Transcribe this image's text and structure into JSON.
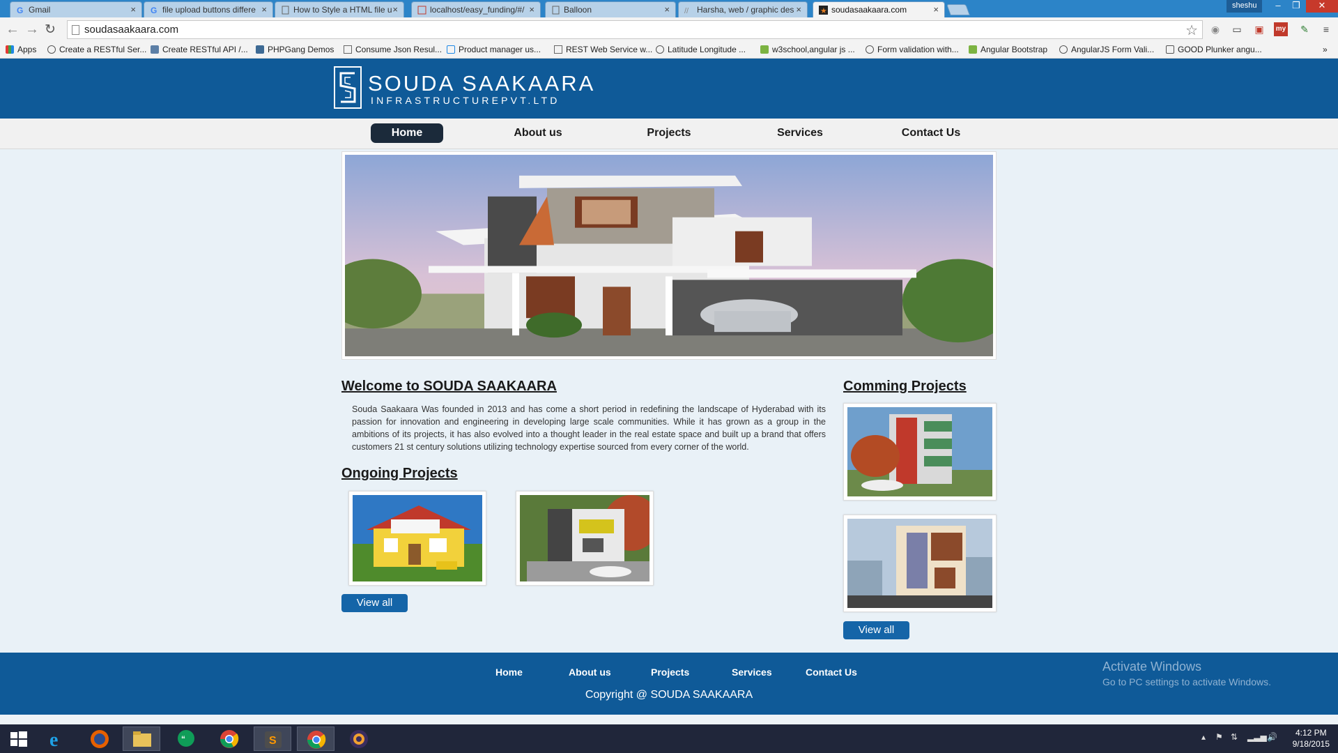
{
  "browser": {
    "tabs": [
      {
        "label": "Gmail",
        "icon": "google-icon"
      },
      {
        "label": "file upload buttons differe",
        "icon": "google-icon"
      },
      {
        "label": "How to Style a HTML file u",
        "icon": "page-icon"
      },
      {
        "label": "localhost/easy_funding/#/",
        "icon": "page-icon"
      },
      {
        "label": "Balloon",
        "icon": "page-icon"
      },
      {
        "label": "Harsha, web / graphic des",
        "icon": "page-icon"
      },
      {
        "label": "soudasaakaara.com",
        "icon": "site-icon",
        "active": true
      }
    ],
    "profile": "sheshu",
    "url": "soudasaakaara.com",
    "bookmarks": [
      "Apps",
      "Create a RESTful Ser...",
      "Create RESTful API /...",
      "PHPGang Demos",
      "Consume Json Resul...",
      "Product manager us...",
      "REST Web Service w...",
      "Latitude Longitude ...",
      "w3school,angular js ...",
      "Form validation with...",
      "Angular Bootstrap",
      "AngularJS Form Vali...",
      "GOOD Plunker angu..."
    ],
    "extensions": [
      "pocket-icon",
      "cast-icon",
      "bus-icon",
      "my-icon",
      "pen-icon",
      "menu-icon"
    ],
    "ext_my_label": "my"
  },
  "site": {
    "logo_title": "SOUDA SAAKAARA",
    "logo_subtitle": "INFRASTRUCTUREPVT.LTD",
    "nav": [
      "Home",
      "About us",
      "Projects",
      "Services",
      "Contact Us"
    ],
    "welcome_title": "Welcome to SOUDA SAAKAARA",
    "welcome_text": "Souda Saakaara Was founded in 2013 and has come a short period in redefining the landscape of Hyderabad with its passion for innovation and engineering in developing large scale communities. While it has grown as a group in the ambitions of its projects, it has also evolved into a thought leader in the real estate space and built up a brand that offers customers 21 st century solutions utilizing technology expertise sourced from every corner of the world.",
    "ongoing_title": "Ongoing Projects",
    "coming_title": "Comming Projects",
    "view_all_label": "View all",
    "footer_nav": [
      "Home",
      "About us",
      "Projects",
      "Services",
      "Contact Us"
    ],
    "copyright": "Copyright @ SOUDA SAAKAARA",
    "activate_line1": "Activate Windows",
    "activate_line2": "Go to PC settings to activate Windows."
  },
  "taskbar": {
    "apps": [
      "windows-start-icon",
      "internet-explorer-icon",
      "firefox-icon",
      "file-explorer-icon",
      "hangouts-icon",
      "chrome-icon",
      "sublime-text-icon",
      "chrome-canary-icon",
      "eclipse-java-ee-icon"
    ],
    "time": "4:12 PM",
    "date": "9/18/2015"
  },
  "colors": {
    "brand_blue": "#0f5a98",
    "nav_active": "#1b2a3a",
    "button_blue": "#1565a8",
    "page_bg": "#e9f1f7"
  }
}
